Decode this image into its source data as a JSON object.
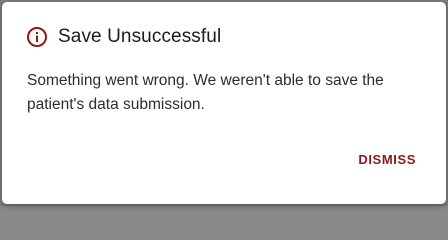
{
  "dialog": {
    "title": "Save Unsuccessful",
    "icon": "error-info-icon",
    "message": "Something went wrong. We weren't able to save the patient's data submission.",
    "dismiss_label": "DISMISS",
    "accent_color": "#8b1a1a"
  }
}
